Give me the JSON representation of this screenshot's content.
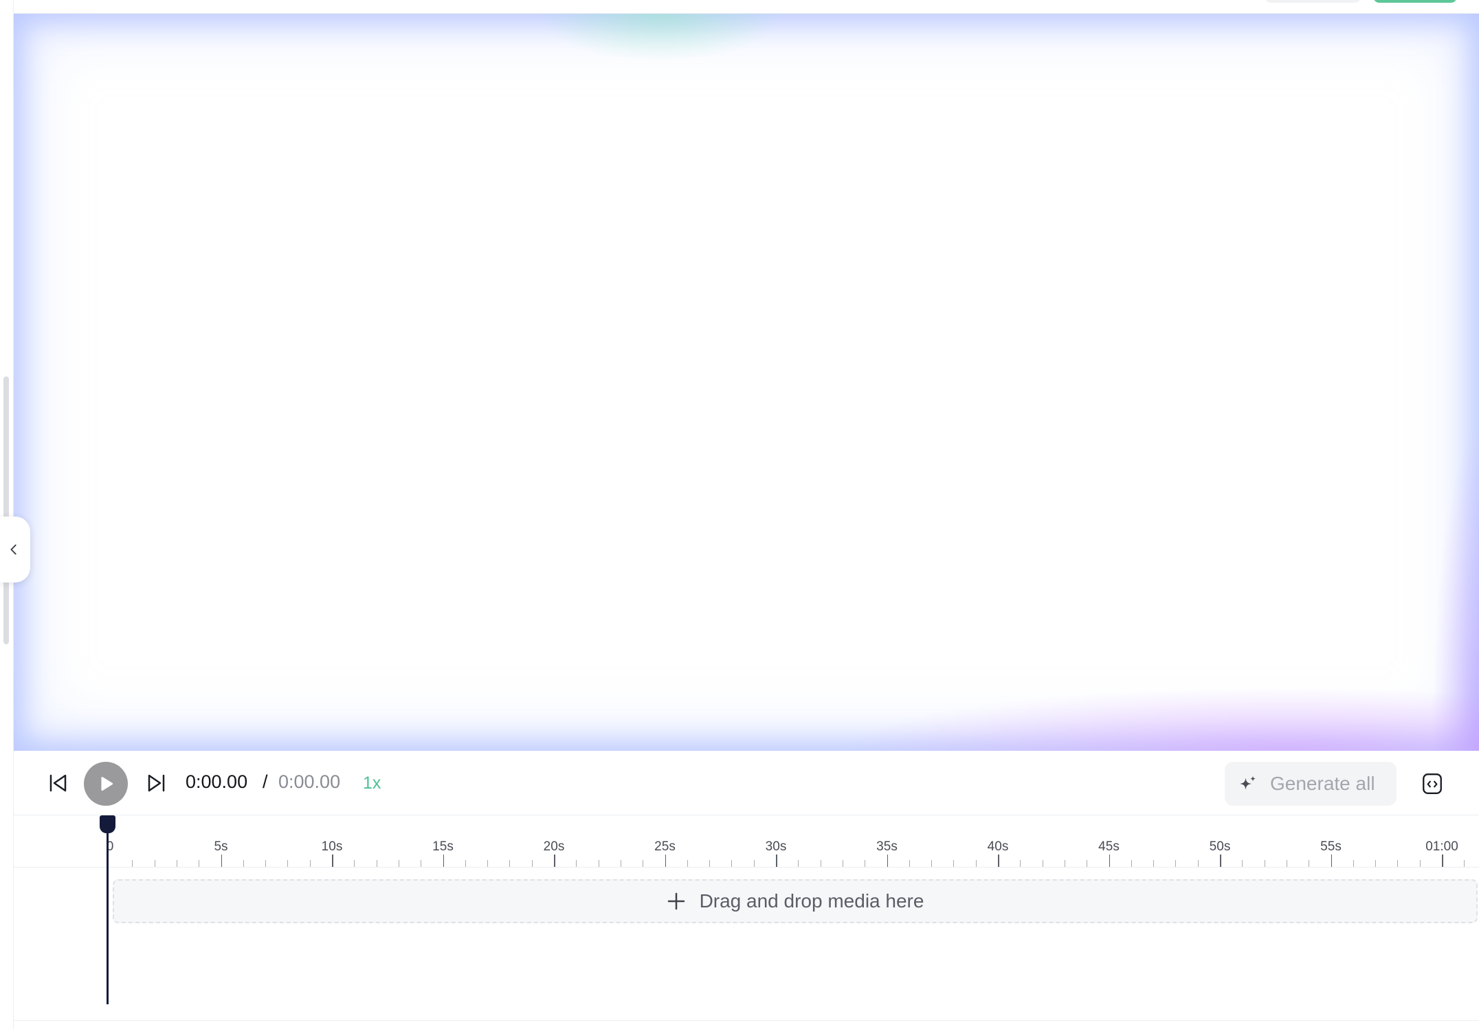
{
  "controls": {
    "current_time": "0:00.00",
    "separator": "/",
    "total_time": "0:00.00",
    "speed": "1x",
    "generate_all_label": "Generate all"
  },
  "timeline": {
    "ruler_labels": [
      "0",
      "5s",
      "10s",
      "15s",
      "20s",
      "25s",
      "30s",
      "35s",
      "40s",
      "45s",
      "50s",
      "55s",
      "01:00"
    ],
    "playhead_time": "0:00.00",
    "drop_zone_label": "Drag and drop media here"
  },
  "colors": {
    "accent_green": "#4fc194",
    "playhead": "#141a3a",
    "play_button": "#9a9a9c"
  },
  "icons": {
    "skip_back": "skip-back-icon",
    "play": "play-icon",
    "skip_forward": "skip-forward-icon",
    "generate": "sparkle-icon",
    "embed": "code-file-icon",
    "collapse": "chevron-left-icon",
    "add": "plus-icon"
  }
}
